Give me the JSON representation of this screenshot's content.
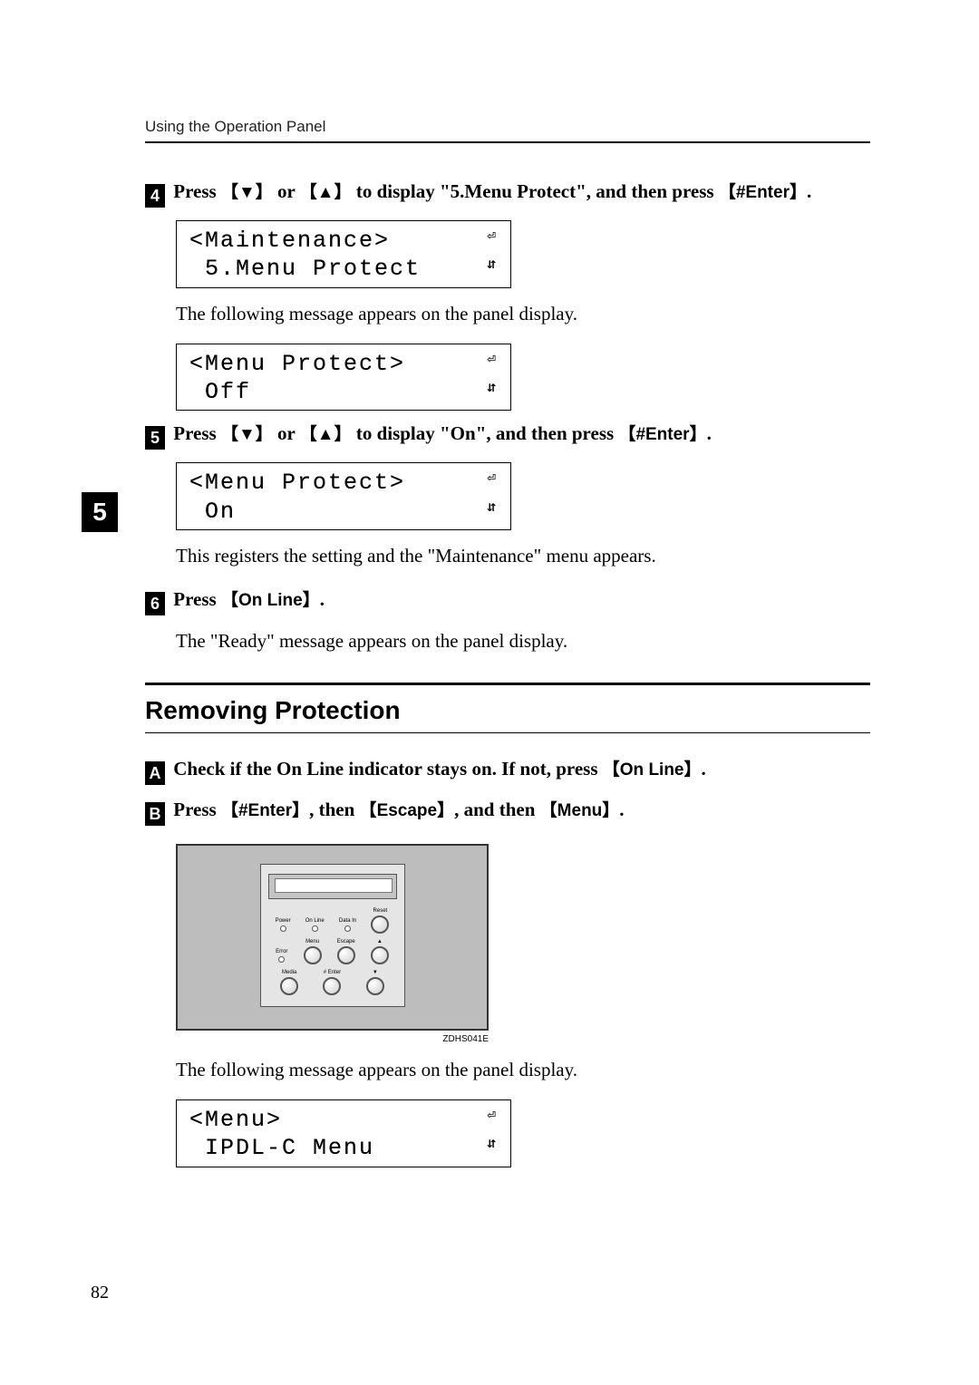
{
  "header": "Using the Operation Panel",
  "chapter_tab": "5",
  "page_number": "82",
  "steps_top": {
    "s4": {
      "num": "4",
      "text_pre": "Press ",
      "key_down": "▼",
      "text_or": " or ",
      "key_up": "▲",
      "text_mid": " to display \"5.Menu Protect\", and then press ",
      "key_enter": "#Enter",
      "text_end": "."
    },
    "display4": {
      "line1": "<Maintenance>",
      "line2": " 5.Menu Protect"
    },
    "after4": "The following message appears on the panel display.",
    "display4b": {
      "line1": "<Menu Protect>",
      "line2": " Off"
    },
    "s5": {
      "num": "5",
      "text_pre": "Press ",
      "key_down": "▼",
      "text_or": " or ",
      "key_up": "▲",
      "text_mid": " to display \"On\", and then press ",
      "key_enter": "#Enter",
      "text_end": "."
    },
    "display5": {
      "line1": "<Menu Protect>",
      "line2": " On"
    },
    "after5": "This registers the setting and the \"Maintenance\" menu appears.",
    "s6": {
      "num": "6",
      "text_pre": "Press ",
      "key_online": "On Line",
      "text_end": "."
    },
    "after6": "The \"Ready\" message appears on the panel display."
  },
  "section2_title": "Removing Protection",
  "steps_bottom": {
    "sA": {
      "letter": "A",
      "text_pre": "Check if the On Line indicator stays on. If not, press ",
      "key_online": "On Line",
      "text_end": "."
    },
    "sB": {
      "letter": "B",
      "text_pre": "Press ",
      "key_enter": "#Enter",
      "text_c1": ", then ",
      "key_escape": "Escape",
      "text_c2": ", and then ",
      "key_menu": "Menu",
      "text_end": "."
    },
    "figure_id": "ZDHS041E",
    "panel": {
      "row1": {
        "power": "Power",
        "online": "On Line",
        "datain": "Data In",
        "reset": "Reset"
      },
      "row2": {
        "error": "Error",
        "menu": "Menu",
        "escape": "Escape",
        "up": "▲"
      },
      "row3": {
        "media": "Media",
        "enter": "# Enter",
        "down": "▼"
      }
    },
    "afterFig": "The following message appears on the panel display.",
    "displayB": {
      "line1": "<Menu>",
      "line2": " IPDL-C Menu"
    }
  }
}
